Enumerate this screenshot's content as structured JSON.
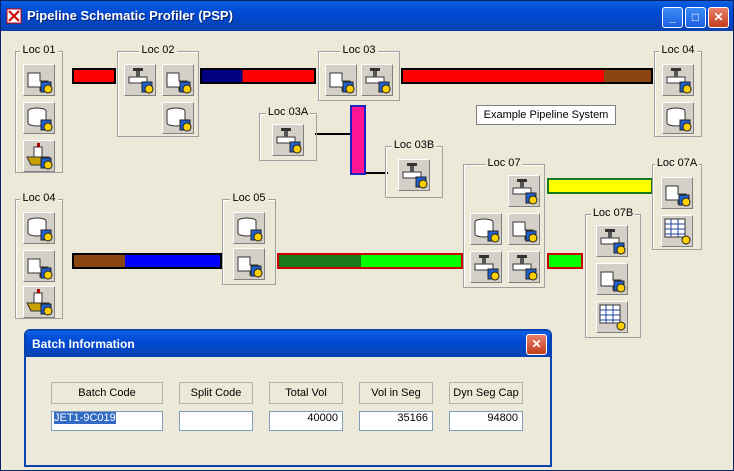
{
  "app": {
    "title": "Pipeline Schematic Profiler (PSP)",
    "min": "_",
    "max": "□",
    "close": "✕"
  },
  "locations": [
    {
      "id": "loc01",
      "label": "Loc 01"
    },
    {
      "id": "loc02",
      "label": "Loc 02"
    },
    {
      "id": "loc03",
      "label": "Loc 03"
    },
    {
      "id": "loc04a",
      "label": "Loc 04"
    },
    {
      "id": "loc03a",
      "label": "Loc 03A"
    },
    {
      "id": "loc03b",
      "label": "Loc 03B"
    },
    {
      "id": "loc07",
      "label": "Loc 07"
    },
    {
      "id": "loc07a",
      "label": "Loc 07A"
    },
    {
      "id": "loc04b",
      "label": "Loc 04"
    },
    {
      "id": "loc05",
      "label": "Loc 05"
    },
    {
      "id": "loc07b",
      "label": "Loc 07B"
    }
  ],
  "example_label": "Example Pipeline System",
  "colors": {
    "red": "#ff0000",
    "navy": "#000080",
    "brown": "#8b4513",
    "blue": "#0000ff",
    "magenta": "#ff1493",
    "yellow": "#ffff00",
    "green": "#00ff00",
    "darkgreen": "#1a7a1a"
  },
  "batch": {
    "title": "Batch Information",
    "close": "✕",
    "headers": [
      "Batch Code",
      "Split Code",
      "Total Vol",
      "Vol in Seg",
      "Dyn Seg Cap"
    ],
    "values": [
      "JET1-9C019",
      "",
      "40000",
      "35166",
      "94800"
    ]
  }
}
